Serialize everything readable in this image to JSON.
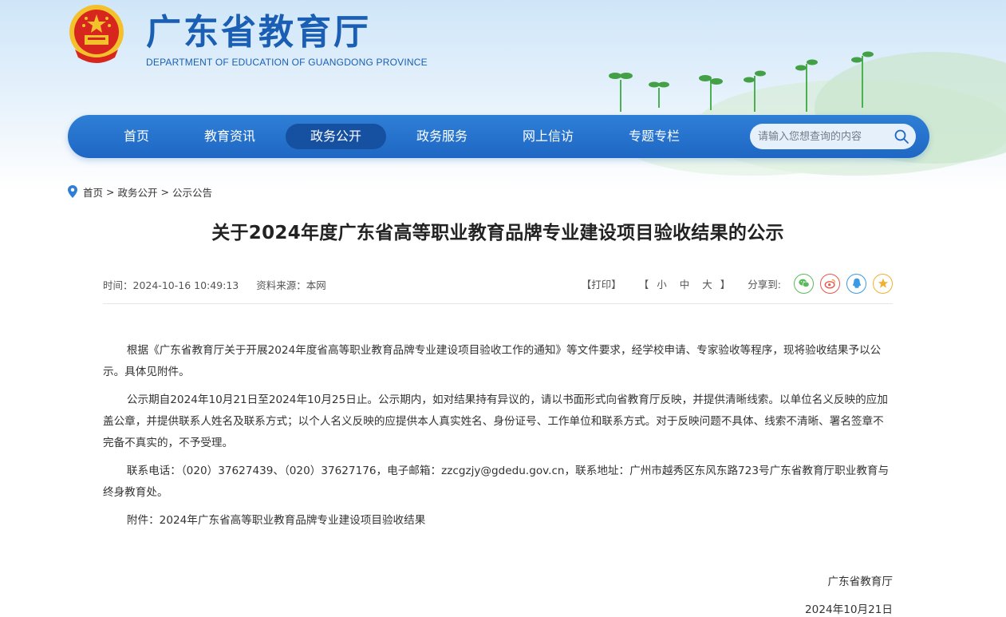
{
  "header": {
    "title": "广东省教育厅",
    "subtitle": "DEPARTMENT OF EDUCATION OF GUANGDONG PROVINCE"
  },
  "nav": {
    "items": [
      {
        "label": "首页",
        "active": false
      },
      {
        "label": "教育资讯",
        "active": false
      },
      {
        "label": "政务公开",
        "active": true
      },
      {
        "label": "政务服务",
        "active": false
      },
      {
        "label": "网上信访",
        "active": false
      },
      {
        "label": "专题专栏",
        "active": false
      }
    ],
    "search_placeholder": "请输入您想查询的内容"
  },
  "breadcrumb": {
    "items": [
      "首页",
      "政务公开",
      "公示公告"
    ],
    "separator": ">"
  },
  "article": {
    "title": "关于2024年度广东省高等职业教育品牌专业建设项目验收结果的公示",
    "time": "时间：2024-10-16 10:49:13",
    "source": "资料来源：本网",
    "print_label": "【打印】",
    "font_size_open": "【",
    "font_size_small": "小",
    "font_size_medium": "中",
    "font_size_large": "大",
    "font_size_close": "】",
    "share_label": "分享到:",
    "share_icons": [
      {
        "name": "wechat-icon",
        "color": "#5cb85c"
      },
      {
        "name": "weibo-icon",
        "color": "#e8574b"
      },
      {
        "name": "qq-icon",
        "color": "#3b9ae6"
      },
      {
        "name": "favorite-star-icon",
        "color": "#f0b030"
      }
    ],
    "paragraphs": [
      "根据《广东省教育厅关于开展2024年度省高等职业教育品牌专业建设项目验收工作的通知》等文件要求，经学校申请、专家验收等程序，现将验收结果予以公示。具体见附件。",
      "公示期自2024年10月21日至2024年10月25日止。公示期内，如对结果持有异议的，请以书面形式向省教育厅反映，并提供清晰线索。以单位名义反映的应加盖公章，并提供联系人姓名及联系方式；以个人名义反映的应提供本人真实姓名、身份证号、工作单位和联系方式。对于反映问题不具体、线索不清晰、署名签章不完备不真实的，不予受理。",
      "联系电话：（020）37627439、（020）37627176，电子邮箱：zzcgzjy@gdedu.gov.cn，联系地址：广州市越秀区东风东路723号广东省教育厅职业教育与终身教育处。",
      "附件：2024年广东省高等职业教育品牌专业建设项目验收结果"
    ],
    "signature_org": "广东省教育厅",
    "signature_date": "2024年10月21日"
  },
  "colors": {
    "brand_blue": "#1a5fb4",
    "nav_active": "#1650a0",
    "emblem_red": "#d7261e",
    "emblem_gold": "#f3c12c"
  }
}
